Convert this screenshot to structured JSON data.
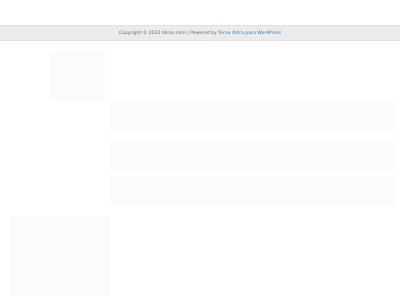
{
  "footer": {
    "copyright": "Copyright © 2022 libros.com",
    "separator": " | Powered by ",
    "theme_link": "Tema Astra para WordPress"
  }
}
